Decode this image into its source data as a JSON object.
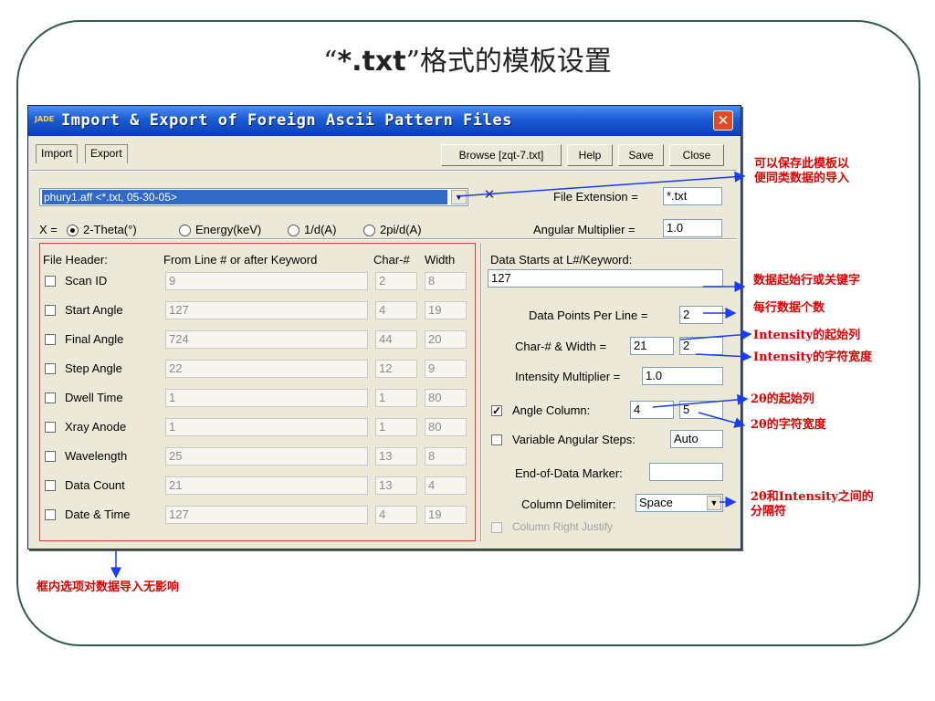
{
  "slide": {
    "title_open": "“",
    "title_ext": "*.txt",
    "title_close": "”",
    "title_rest": "格式的模板设置"
  },
  "dialog": {
    "title": "Import & Export of Foreign Ascii Pattern Files",
    "app_icon": "JADE",
    "close_glyph": "✕",
    "tabs": [
      "Import",
      "Export"
    ],
    "buttons": [
      "Browse [zqt-7.txt]",
      "Help",
      "Save",
      "Close"
    ],
    "template_select": "phury1.aff <*.txt, 05-30-05>",
    "clear_glyph": "✕",
    "file_extension_label": "File Extension =",
    "file_extension": "*.txt",
    "x_label": "X =",
    "x_options": [
      "2-Theta(°)",
      "Energy(keV)",
      "1/d(A)",
      "2pi/d(A)"
    ],
    "x_selected": "2-Theta(°)",
    "angular_multiplier_label": "Angular Multiplier =",
    "angular_multiplier": "1.0",
    "header_cols": {
      "file_header": "File Header:",
      "from_line": "From Line # or after Keyword",
      "char": "Char-#",
      "width": "Width"
    },
    "header_rows": [
      {
        "label": "Scan ID",
        "line": "9",
        "char": "2",
        "width": "8"
      },
      {
        "label": "Start Angle",
        "line": "127",
        "char": "4",
        "width": "19"
      },
      {
        "label": "Final Angle",
        "line": "724",
        "char": "44",
        "width": "20"
      },
      {
        "label": "Step Angle",
        "line": "22",
        "char": "12",
        "width": "9"
      },
      {
        "label": "Dwell Time",
        "line": "1",
        "char": "1",
        "width": "80"
      },
      {
        "label": "Xray Anode",
        "line": "1",
        "char": "1",
        "width": "80"
      },
      {
        "label": "Wavelength",
        "line": "25",
        "char": "13",
        "width": "8"
      },
      {
        "label": "Data Count",
        "line": "21",
        "char": "13",
        "width": "4"
      },
      {
        "label": "Date & Time",
        "line": "127",
        "char": "4",
        "width": "19"
      }
    ],
    "data_starts_label": "Data Starts at L#/Keyword:",
    "data_starts": "127",
    "points_per_line_label": "Data Points Per Line =",
    "points_per_line": "2",
    "char_width_label": "Char-# & Width =",
    "intensity_char": "21",
    "intensity_width": "2",
    "intensity_multiplier_label": "Intensity Multiplier =",
    "intensity_multiplier": "1.0",
    "angle_column_label": "Angle Column:",
    "angle_column_checked": true,
    "angle_char": "4",
    "angle_width": "5",
    "variable_steps_label": "Variable Angular Steps:",
    "variable_steps": "Auto",
    "end_marker_label": "End-of-Data Marker:",
    "end_marker": "",
    "delimiter_label": "Column Delimiter:",
    "delimiter": "Space",
    "right_justify_label": "Column Right Justify"
  },
  "annotations": {
    "save_template": [
      "可以保存此模板以",
      "便同类数据的导入"
    ],
    "data_start": "数据起始行或关键字",
    "points_per_line": "每行数据个数",
    "intensity_start": "Intensity的起始列",
    "intensity_width": "Intensity的字符宽度",
    "angle_start": "2θ的起始列",
    "angle_width": "2θ的字符宽度",
    "delimiter": [
      "2θ和Intensity之间的",
      "分隔符"
    ],
    "box_note": "框内选项对数据导入无影响"
  },
  "colors": {
    "annotation": "#e00000",
    "arrow": "#1a3cff",
    "title_bar": "#0a3fb4",
    "box": "#d84040"
  }
}
